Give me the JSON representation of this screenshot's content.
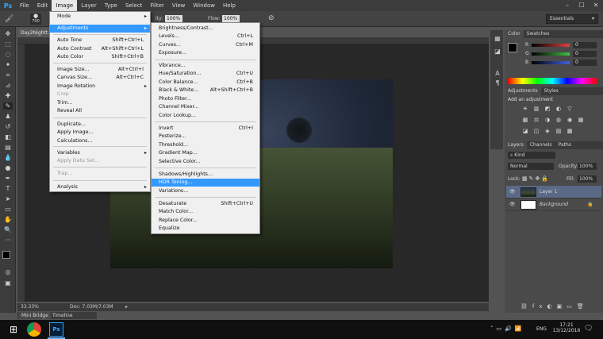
{
  "menubar": {
    "logo": "Ps",
    "items": [
      "File",
      "Edit",
      "Image",
      "Layer",
      "Type",
      "Select",
      "Filter",
      "View",
      "Window",
      "Help"
    ],
    "active": "Image"
  },
  "options": {
    "brush_size": "700",
    "opacity_label": "ity:",
    "opacity": "100%",
    "flow_label": "Flow:",
    "flow": "100%",
    "workspace": "Essentials"
  },
  "document": {
    "tab": "Day2Nightt...",
    "zoom": "33.33%",
    "doc_info": "Doc: 7.03M/7.03M"
  },
  "bottom_tabs": [
    "Mini Bridge",
    "Timeline"
  ],
  "image_menu": [
    {
      "label": "Mode",
      "arrow": true
    },
    {
      "label": "Adjustments",
      "arrow": true,
      "highlight": true
    },
    {
      "label": "Auto Tone",
      "shortcut": "Shift+Ctrl+L"
    },
    {
      "label": "Auto Contrast",
      "shortcut": "Alt+Shift+Ctrl+L"
    },
    {
      "label": "Auto Color",
      "shortcut": "Shift+Ctrl+B"
    },
    {
      "label": "Image Size...",
      "shortcut": "Alt+Ctrl+I"
    },
    {
      "label": "Canvas Size...",
      "shortcut": "Alt+Ctrl+C"
    },
    {
      "label": "Image Rotation",
      "arrow": true
    },
    {
      "label": "Crop",
      "disabled": true
    },
    {
      "label": "Trim..."
    },
    {
      "label": "Reveal All"
    },
    {
      "label": "Duplicate..."
    },
    {
      "label": "Apply Image..."
    },
    {
      "label": "Calculations..."
    },
    {
      "label": "Variables",
      "arrow": true
    },
    {
      "label": "Apply Data Set...",
      "disabled": true
    },
    {
      "label": "Trap...",
      "disabled": true
    },
    {
      "label": "Analysis",
      "arrow": true
    }
  ],
  "adjust_menu": [
    {
      "label": "Brightness/Contrast..."
    },
    {
      "label": "Levels...",
      "shortcut": "Ctrl+L"
    },
    {
      "label": "Curves...",
      "shortcut": "Ctrl+M"
    },
    {
      "label": "Exposure..."
    },
    {
      "label": "Vibrance..."
    },
    {
      "label": "Hue/Saturation...",
      "shortcut": "Ctrl+U"
    },
    {
      "label": "Color Balance...",
      "shortcut": "Ctrl+B"
    },
    {
      "label": "Black & White...",
      "shortcut": "Alt+Shift+Ctrl+B"
    },
    {
      "label": "Photo Filter..."
    },
    {
      "label": "Channel Mixer..."
    },
    {
      "label": "Color Lookup..."
    },
    {
      "label": "Invert",
      "shortcut": "Ctrl+I"
    },
    {
      "label": "Posterize..."
    },
    {
      "label": "Threshold..."
    },
    {
      "label": "Gradient Map..."
    },
    {
      "label": "Selective Color..."
    },
    {
      "label": "Shadows/Highlights..."
    },
    {
      "label": "HDR Toning...",
      "highlight": true
    },
    {
      "label": "Variations..."
    },
    {
      "label": "Desaturate",
      "shortcut": "Shift+Ctrl+U"
    },
    {
      "label": "Match Color..."
    },
    {
      "label": "Replace Color..."
    },
    {
      "label": "Equalize"
    }
  ],
  "color_panel": {
    "tabs": [
      "Color",
      "Swatches"
    ],
    "channels": [
      {
        "name": "R",
        "value": "0",
        "color": "#e04040"
      },
      {
        "name": "G",
        "value": "0",
        "color": "#40c040"
      },
      {
        "name": "B",
        "value": "0",
        "color": "#4060e0"
      }
    ]
  },
  "adjustments_panel": {
    "tabs": [
      "Adjustments",
      "Styles"
    ],
    "hint": "Add an adjustment"
  },
  "layers_panel": {
    "tabs": [
      "Layers",
      "Channels",
      "Paths"
    ],
    "kind": "Kind",
    "blend_mode": "Normal",
    "opacity_label": "Opacity:",
    "opacity": "100%",
    "lock_label": "Lock:",
    "fill_label": "Fill:",
    "fill": "100%",
    "layers": [
      {
        "name": "Layer 1",
        "selected": true
      },
      {
        "name": "Background",
        "italic": true
      }
    ]
  },
  "taskbar": {
    "language": "ENG",
    "time": "17:21",
    "date": "13/12/2016"
  }
}
